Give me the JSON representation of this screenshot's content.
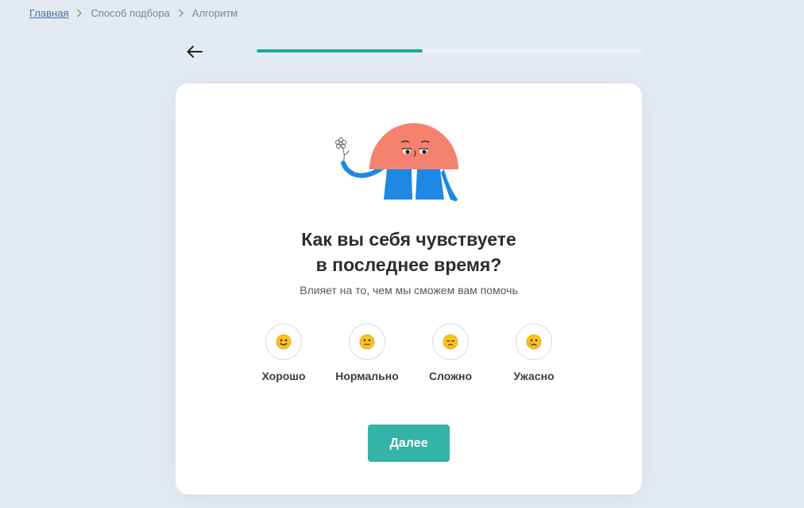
{
  "breadcrumb": {
    "home": "Главная",
    "method": "Способ подбора",
    "current": "Алгоритм"
  },
  "progress": {
    "fraction": 0.43,
    "fill_color": "#1aaa9b",
    "track_color": "#f1f4f7"
  },
  "question": {
    "title_line1": "Как вы себя чувствуете",
    "title_line2": "в последнее время?",
    "subtitle": "Влияет на то, чем мы сможем вам помочь"
  },
  "options": [
    {
      "label": "Хорошо",
      "icon": "slightly-smiling-face-icon"
    },
    {
      "label": "Нормально",
      "icon": "neutral-face-icon"
    },
    {
      "label": "Сложно",
      "icon": "pensive-face-icon"
    },
    {
      "label": "Ужасно",
      "icon": "crying-face-icon"
    }
  ],
  "actions": {
    "next_label": "Далее"
  },
  "colors": {
    "accent": "#34b3a6",
    "background": "#e4eaf1",
    "character_head": "#f4826f",
    "character_body": "#1e88e5"
  }
}
